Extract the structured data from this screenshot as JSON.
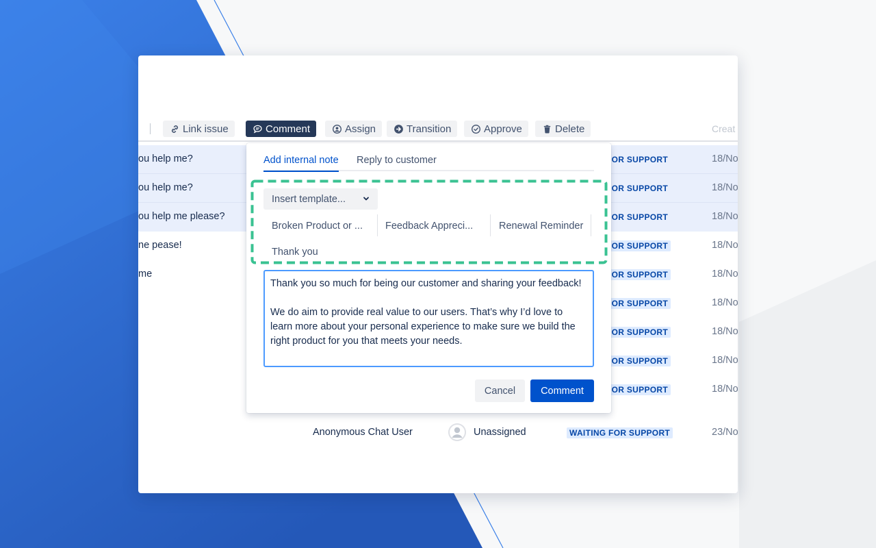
{
  "colors": {
    "accent": "#0052cc",
    "active_toolbar": "#253858",
    "template_outline": "#2fbf8c",
    "background_blue": "#2f6fd6"
  },
  "toolbar": {
    "buttons": [
      {
        "label": "Link issue",
        "icon": "link-icon"
      },
      {
        "label": "Comment",
        "icon": "comment-icon",
        "active": true
      },
      {
        "label": "Assign",
        "icon": "user-circle-icon"
      },
      {
        "label": "Transition",
        "icon": "arrow-circle-icon"
      },
      {
        "label": "Approve",
        "icon": "check-circle-icon"
      },
      {
        "label": "Delete",
        "icon": "trash-icon"
      }
    ],
    "column_created": "Creat"
  },
  "table": {
    "rows": [
      {
        "summary": "ou help me?",
        "status": "FOR SUPPORT",
        "date": "18/No",
        "highlighted": true
      },
      {
        "summary": "ou help me?",
        "status": "FOR SUPPORT",
        "date": "18/No",
        "highlighted": true
      },
      {
        "summary": "ou help me please?",
        "status": "FOR SUPPORT",
        "date": "18/No",
        "highlighted": true
      },
      {
        "summary": "ne pease!",
        "status": "FOR SUPPORT",
        "date": "18/No",
        "highlighted": false
      },
      {
        "summary": "me",
        "status": "FOR SUPPORT",
        "date": "18/No",
        "highlighted": false
      },
      {
        "summary": "",
        "status": "FOR SUPPORT",
        "date": "18/No",
        "highlighted": false
      },
      {
        "summary": "",
        "status": "FOR SUPPORT",
        "date": "18/No",
        "highlighted": false
      },
      {
        "summary": "",
        "status": "FOR SUPPORT",
        "date": "18/No",
        "highlighted": false
      },
      {
        "summary": "",
        "status": "FOR SUPPORT",
        "date": "18/No",
        "highlighted": false
      }
    ],
    "last_row": {
      "reporter": "Anonymous Chat User",
      "assignee": "Unassigned",
      "status": "WAITING FOR SUPPORT",
      "date": "23/No"
    }
  },
  "popup": {
    "tabs": [
      {
        "label": "Add internal note",
        "active": true
      },
      {
        "label": "Reply to customer",
        "active": false
      }
    ],
    "insert_template_label": "Insert template...",
    "templates": [
      "Broken Product or ...",
      "Feedback Appreci...",
      "Renewal Reminder",
      "Thank you"
    ],
    "editor": {
      "paragraph1": "Thank you so much for being our customer and sharing your feedback!",
      "paragraph2": "We do aim to provide real value to our users. That’s why I’d love to learn more about your personal experience to make sure we build the right product for you that meets your needs."
    },
    "cancel_label": "Cancel",
    "comment_label": "Comment"
  }
}
